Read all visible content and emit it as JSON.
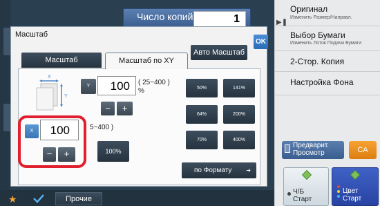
{
  "header": {
    "copies_label": "Число копий",
    "copies_value": "1"
  },
  "right_panel": {
    "items": [
      {
        "label": "Оригинал",
        "sub": "Изменить Размер/Направл."
      },
      {
        "label": "Выбор Бумаги",
        "sub": "Изменить Лоток Подачи Бумаги"
      },
      {
        "label": "2-Стор. Копия",
        "sub": ""
      },
      {
        "label": "Настройка Фона",
        "sub": ""
      }
    ],
    "preview_label_1": "Предварит.",
    "preview_label_2": "Просмотр",
    "ca_label": "CA",
    "bw_start_1": "Ч/Б",
    "bw_start_2": "Старт",
    "color_start_1": "Цвет",
    "color_start_2": "Старт",
    "colors": {
      "ca": "#f0921f",
      "color_start": "#3254b8",
      "start_diamond": "#7fc05a"
    }
  },
  "dialog": {
    "title": "Масштаб",
    "ok_label": "OK",
    "tabs": {
      "scale": "Масштаб",
      "scale_xy": "Масштаб по XY",
      "auto": "Авто Масштаб"
    },
    "y": {
      "badge": "Y",
      "value": "100",
      "range": "( 25~400 )",
      "unit": "%"
    },
    "x": {
      "badge": "X",
      "value": "100",
      "range": "5~400 )"
    },
    "btn_100": "100%",
    "presets": [
      "50%",
      "141%",
      "64%",
      "200%",
      "70%",
      "400%"
    ],
    "by_format": "по Формату",
    "illustration": {
      "x_letter": "X",
      "y_letter": "Y"
    }
  },
  "bottom": {
    "other_label": "Прочие"
  },
  "accent_colors": {
    "highlight": "#e0202f",
    "active_badge": "#4a88c8"
  }
}
